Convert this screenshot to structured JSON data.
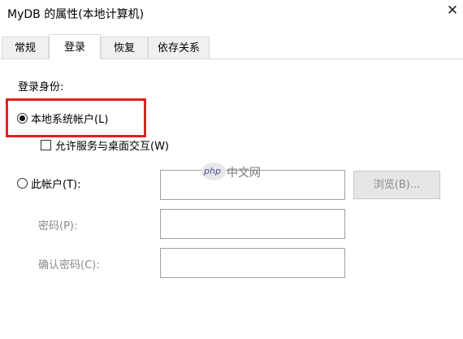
{
  "window": {
    "title": "MyDB 的属性(本地计算机)",
    "close_symbol": "✕"
  },
  "tabs": [
    {
      "label": "常规",
      "active": false
    },
    {
      "label": "登录",
      "active": true
    },
    {
      "label": "恢复",
      "active": false
    },
    {
      "label": "依存关系",
      "active": false
    }
  ],
  "logon": {
    "section_label": "登录身份:",
    "local_system_label": "本地系统帐户(L)",
    "local_system_selected": true,
    "allow_desktop_label": "允许服务与桌面交互(W)",
    "allow_desktop_checked": false,
    "this_account_label": "此帐户(T):",
    "this_account_value": "",
    "browse_label": "浏览(B)...",
    "password_label": "密码(P):",
    "password_value": "",
    "confirm_password_label": "确认密码(C):",
    "confirm_password_value": ""
  },
  "watermark": {
    "logo": "php",
    "text": "中文网"
  },
  "colors": {
    "highlight": "#e02020",
    "disabled_text": "#8a8a8a"
  }
}
